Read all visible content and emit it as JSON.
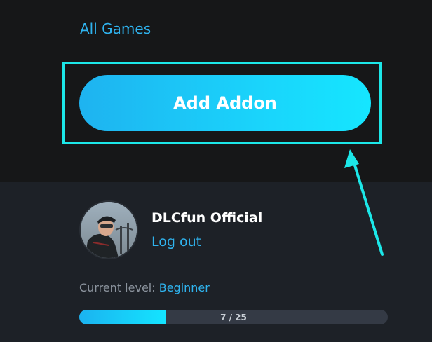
{
  "nav": {
    "all_games_label": "All Games"
  },
  "primary_action": {
    "add_addon_label": "Add Addon"
  },
  "user": {
    "name": "DLCfun Official",
    "logout_label": "Log out",
    "level_label": "Current level:",
    "level_value": "Beginner"
  },
  "progress": {
    "current": 7,
    "total": 25,
    "text": "7 / 25"
  },
  "colors": {
    "accent": "#2fb3ee",
    "highlight": "#1ce7e8",
    "button_start": "#1eb3f0",
    "button_end": "#15e6ff"
  },
  "icons": {
    "annotation": "arrow-icon"
  }
}
